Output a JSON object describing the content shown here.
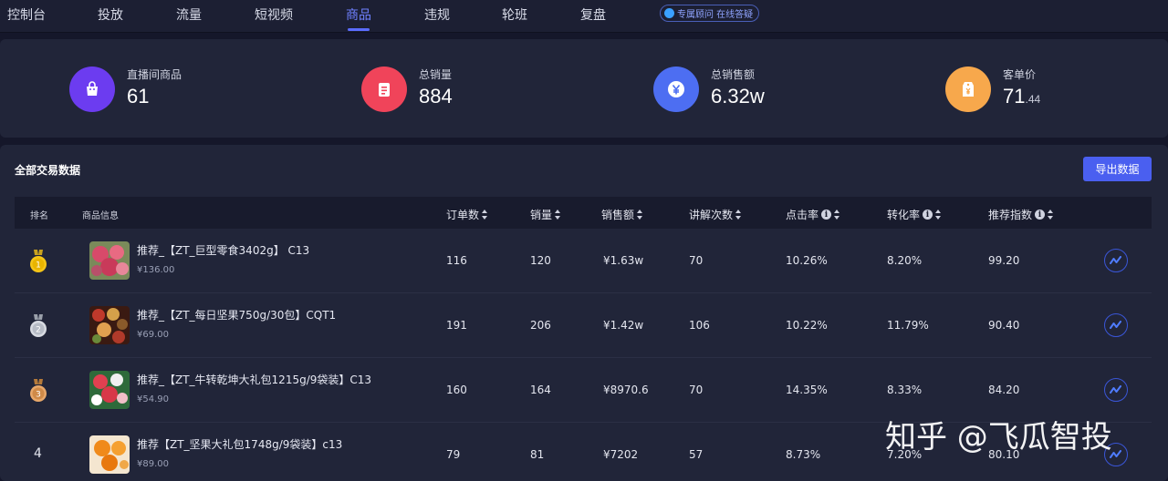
{
  "nav": {
    "tabs": [
      {
        "label": "控制台"
      },
      {
        "label": "投放"
      },
      {
        "label": "流量"
      },
      {
        "label": "短视频"
      },
      {
        "label": "商品"
      },
      {
        "label": "违规"
      },
      {
        "label": "轮班"
      },
      {
        "label": "复盘"
      }
    ],
    "active_tab": "商品",
    "advisor_label": "专属顾问 在线答疑"
  },
  "stats": [
    {
      "label": "直播间商品",
      "value": "61",
      "icon": "shopping-bag-icon",
      "color": "#6c3cf0"
    },
    {
      "label": "总销量",
      "value": "884",
      "icon": "receipt-icon",
      "color": "#f0445a"
    },
    {
      "label": "总销售额",
      "value": "6.32w",
      "icon": "yen-icon",
      "color": "#4d6ef2"
    },
    {
      "label": "客单价",
      "value_main": "71",
      "value_decimal": ".44",
      "icon": "price-tag-icon",
      "color": "#f7a84c"
    }
  ],
  "panel": {
    "title": "全部交易数据",
    "export_label": "导出数据",
    "headers": {
      "rank": "排名",
      "product": "商品信息",
      "orders": "订单数",
      "sales": "销量",
      "revenue": "销售额",
      "explain": "讲解次数",
      "ctr": "点击率",
      "cvr": "转化率",
      "score": "推荐指数"
    },
    "rows": [
      {
        "rank": "1",
        "medal": "gold",
        "name": "推荐_【ZT_巨型零食3402g】 C13",
        "price": "¥136.00",
        "orders": "116",
        "sales": "120",
        "revenue": "¥1.63w",
        "explain": "70",
        "ctr": "10.26%",
        "cvr": "8.20%",
        "score": "99.20"
      },
      {
        "rank": "2",
        "medal": "silver",
        "name": "推荐_【ZT_每日坚果750g/30包】CQT1",
        "price": "¥69.00",
        "orders": "191",
        "sales": "206",
        "revenue": "¥1.42w",
        "explain": "106",
        "ctr": "10.22%",
        "cvr": "11.79%",
        "score": "90.40"
      },
      {
        "rank": "3",
        "medal": "bronze",
        "name": "推荐_【ZT_牛转乾坤大礼包1215g/9袋装】C13",
        "price": "¥54.90",
        "orders": "160",
        "sales": "164",
        "revenue": "¥8970.6",
        "explain": "70",
        "ctr": "14.35%",
        "cvr": "8.33%",
        "score": "84.20"
      },
      {
        "rank": "4",
        "medal": "",
        "name": "推荐【ZT_坚果大礼包1748g/9袋装】c13",
        "price": "¥89.00",
        "orders": "79",
        "sales": "81",
        "revenue": "¥7202",
        "explain": "57",
        "ctr": "8.73%",
        "cvr": "7.20%",
        "score": "80.10"
      }
    ]
  },
  "watermark": "知乎 @飞瓜智投"
}
